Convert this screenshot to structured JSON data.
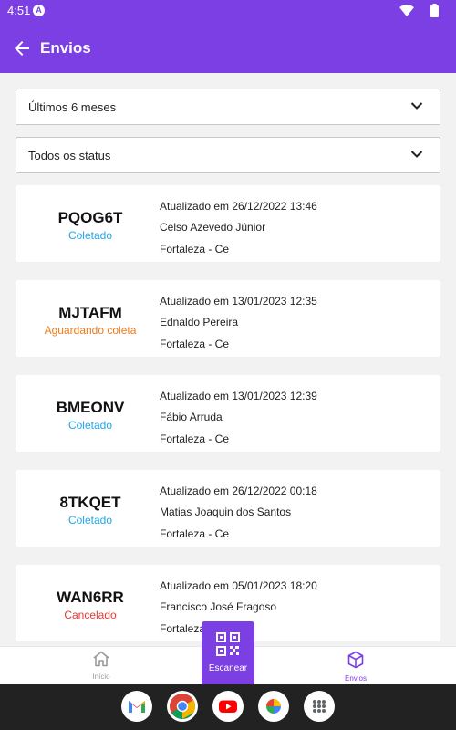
{
  "status_bar": {
    "time": "4:51",
    "badge": "A"
  },
  "app_bar": {
    "title": "Envios"
  },
  "filters": {
    "period": "Últimos 6 meses",
    "status": "Todos os status"
  },
  "colors": {
    "primary": "#7b3fe4",
    "coletado": "#22a7e8",
    "aguardando": "#f07a1a",
    "cancelado": "#e53935"
  },
  "shipments": [
    {
      "code": "PQOG6T",
      "status": "Coletado",
      "status_color": "#22a7e8",
      "updated": "Atualizado em 26/12/2022 13:46",
      "name": "Celso Azevedo Júnior",
      "city": "Fortaleza - Ce"
    },
    {
      "code": "MJTAFM",
      "status": "Aguardando coleta",
      "status_color": "#f07a1a",
      "updated": "Atualizado em 13/01/2023 12:35",
      "name": "Ednaldo Pereira",
      "city": "Fortaleza - Ce"
    },
    {
      "code": "BMEONV",
      "status": "Coletado",
      "status_color": "#22a7e8",
      "updated": "Atualizado em 13/01/2023 12:39",
      "name": "Fábio Arruda",
      "city": "Fortaleza - Ce"
    },
    {
      "code": "8TKQET",
      "status": "Coletado",
      "status_color": "#22a7e8",
      "updated": "Atualizado em 26/12/2022 00:18",
      "name": "Matias Joaquin dos Santos",
      "city": "Fortaleza - Ce"
    },
    {
      "code": "WAN6RR",
      "status": "Cancelado",
      "status_color": "#e53935",
      "updated": "Atualizado em 05/01/2023 18:20",
      "name": "Francisco José Fragoso",
      "city": "Fortaleza - Ce"
    }
  ],
  "bottom_nav": {
    "home_label": "Início",
    "scan_label": "Escanear",
    "envios_label": "Envios"
  },
  "dock": [
    "gmail-icon",
    "chrome-icon",
    "youtube-icon",
    "photos-icon",
    "app-drawer-icon"
  ]
}
